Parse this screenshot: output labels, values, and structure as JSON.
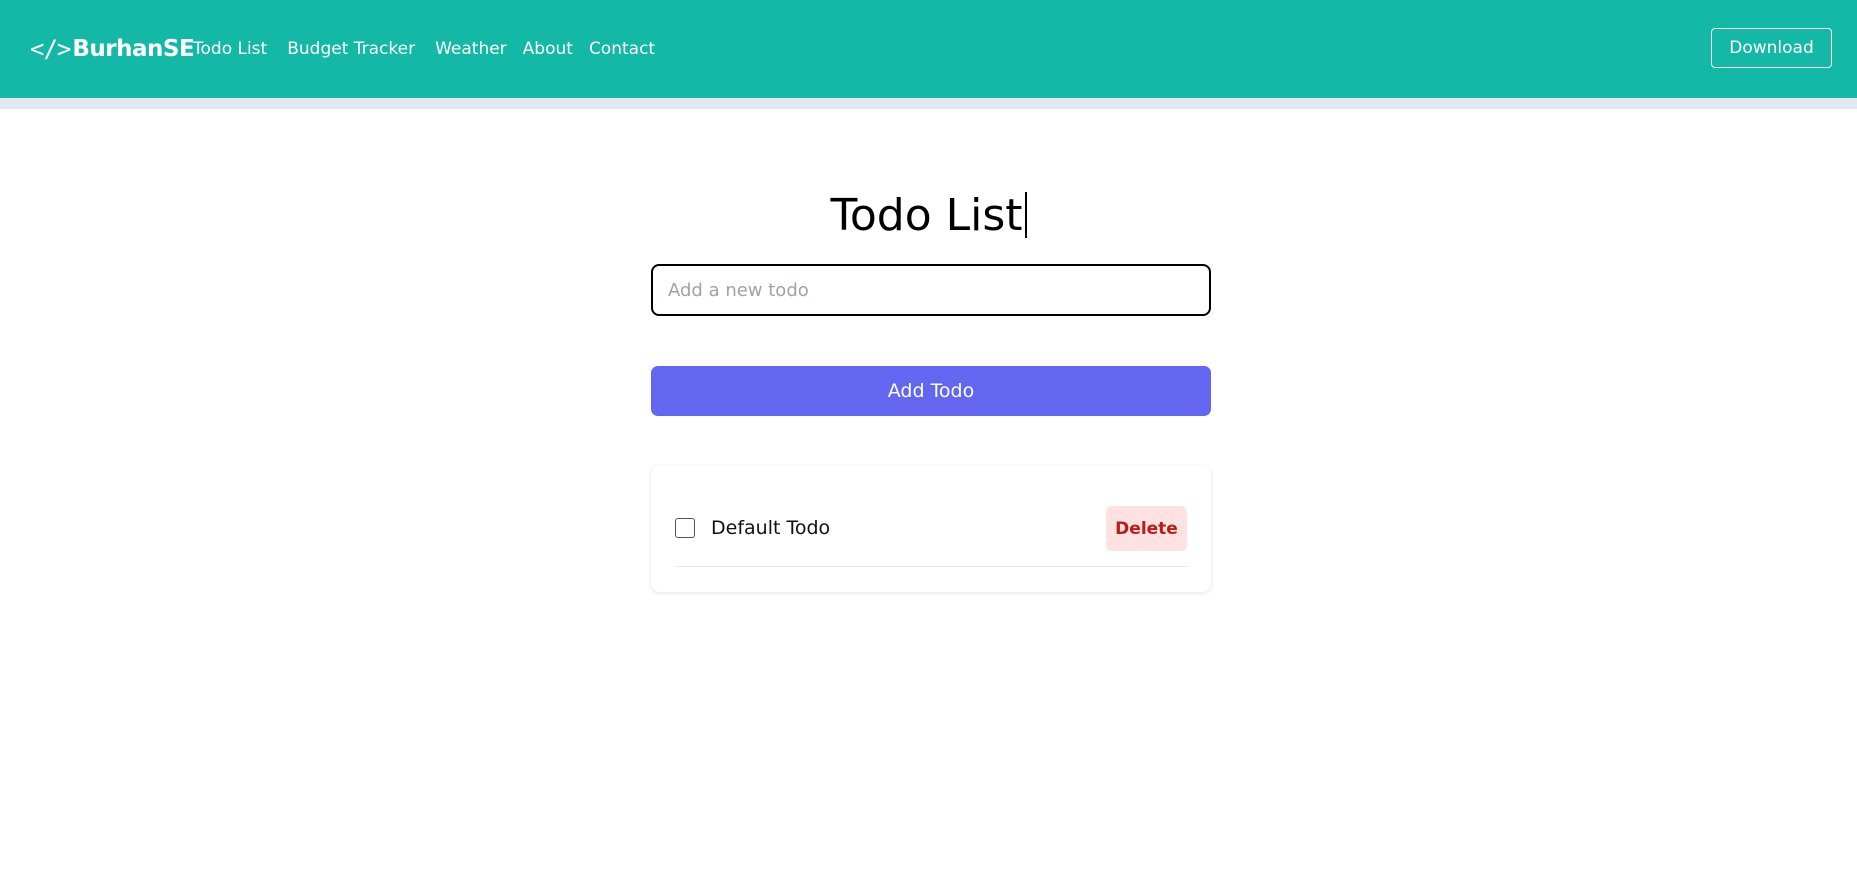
{
  "navbar": {
    "brand_icon": "</>",
    "brand_text": "BurhanSE",
    "links": [
      {
        "label": "Todo List"
      },
      {
        "label": "Budget Tracker"
      },
      {
        "label": "Weather"
      },
      {
        "label": "About"
      },
      {
        "label": "Contact"
      }
    ],
    "download_label": "Download",
    "background_color": "#14b8a6"
  },
  "main": {
    "title": "Todo List",
    "input": {
      "value": "",
      "placeholder": "Add a new todo"
    },
    "add_button_label": "Add Todo",
    "add_button_color": "#6366f1",
    "todos": [
      {
        "text": "Default Todo",
        "completed": false,
        "delete_label": "Delete"
      }
    ]
  }
}
